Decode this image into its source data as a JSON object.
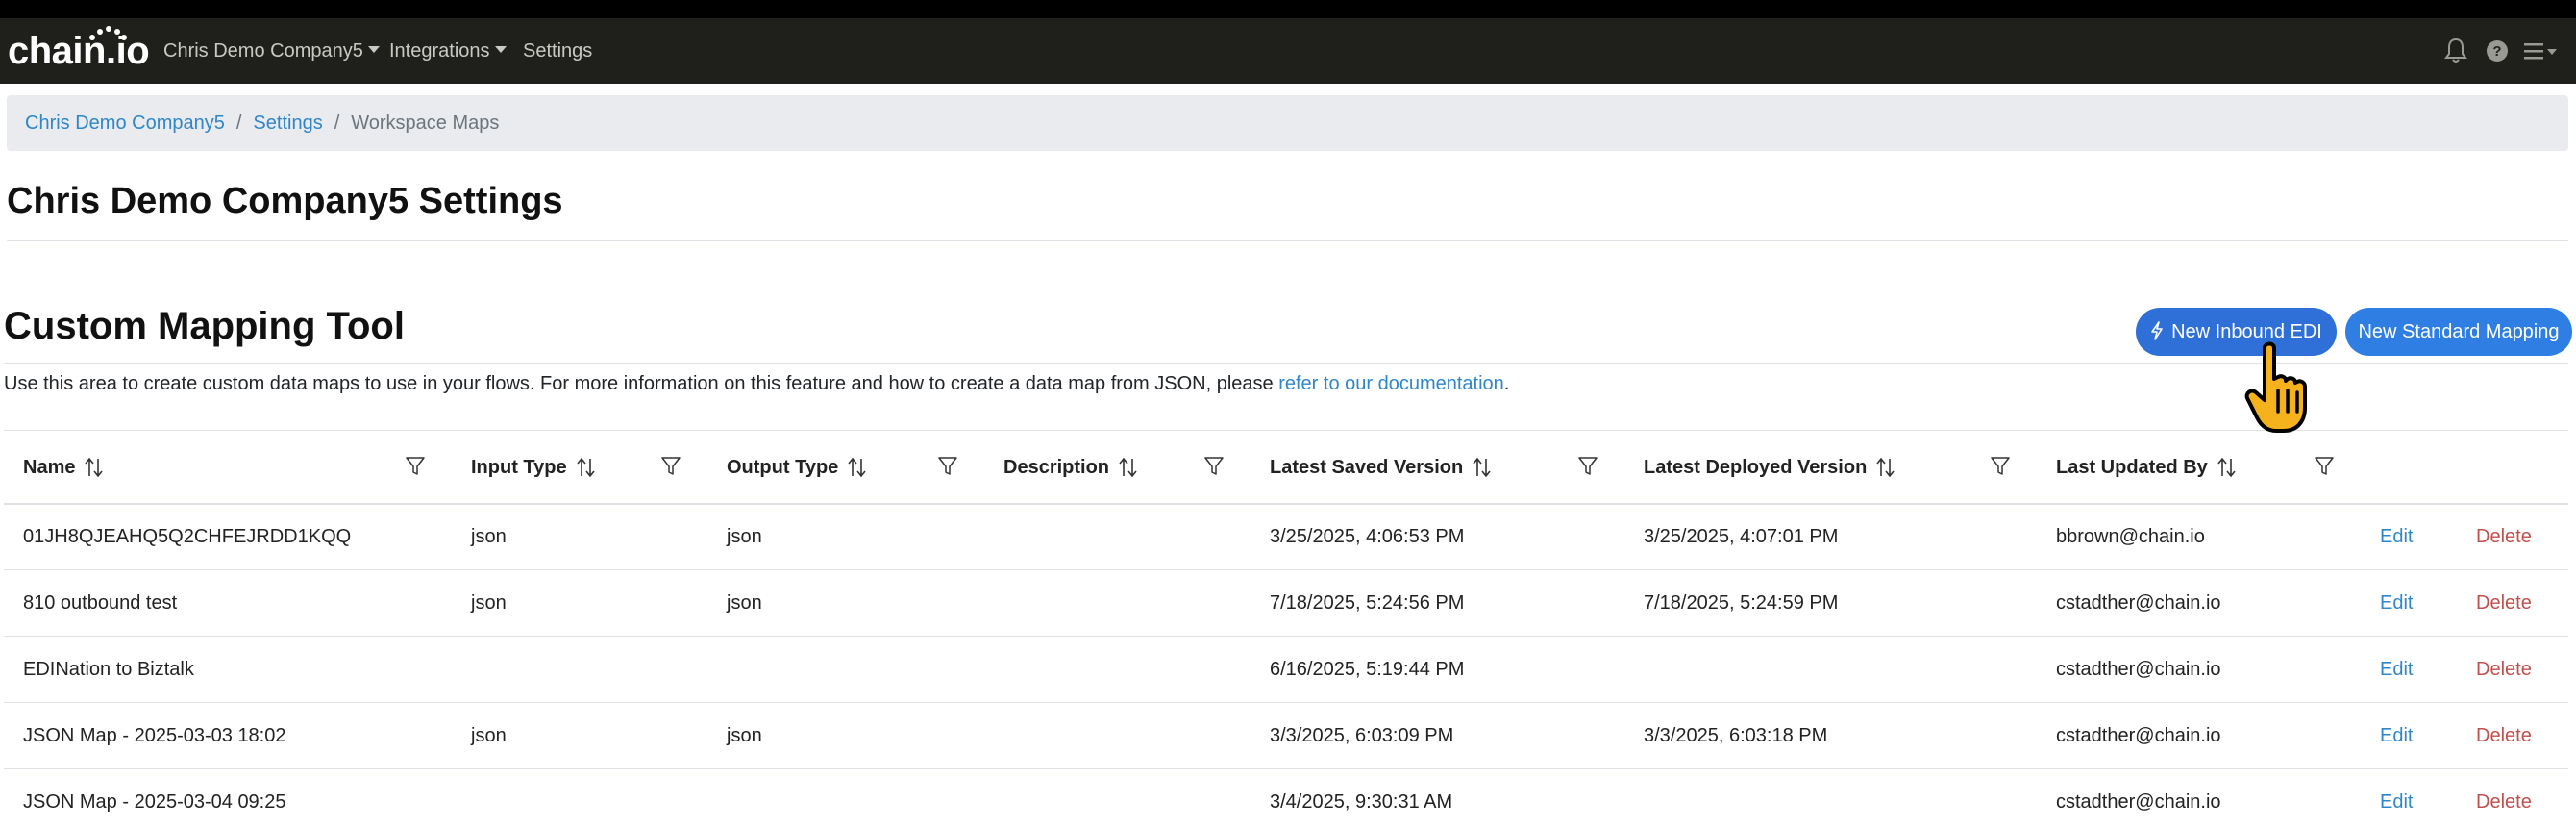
{
  "navbar": {
    "brand": "chain.io",
    "items": [
      {
        "label": "Chris Demo Company5",
        "dropdown": true
      },
      {
        "label": "Integrations",
        "dropdown": true
      },
      {
        "label": "Settings",
        "dropdown": false
      }
    ],
    "icons": [
      "bell-icon",
      "help-icon",
      "hamburger-menu-icon"
    ]
  },
  "breadcrumb": {
    "items": [
      "Chris Demo Company5",
      "Settings"
    ],
    "active": "Workspace Maps",
    "separator": "/"
  },
  "page": {
    "title": "Chris Demo Company5 Settings"
  },
  "section": {
    "title": "Custom Mapping Tool",
    "description_prefix": "Use this area to create custom data maps to use in your flows. For more information on this feature and how to create a data map from JSON, please ",
    "description_link": "refer to our documentation",
    "description_suffix": "."
  },
  "buttons": {
    "new_inbound_edi": "New Inbound EDI",
    "new_standard_mapping": "New Standard Mapping"
  },
  "table": {
    "headers": [
      "Name",
      "Input Type",
      "Output Type",
      "Description",
      "Latest Saved Version",
      "Latest Deployed Version",
      "Last Updated By"
    ],
    "rows": [
      {
        "name": "01JH8QJEAHQ5Q2CHFEJRDD1KQQ",
        "input": "json",
        "output": "json",
        "description": "",
        "saved": "3/25/2025, 4:06:53 PM",
        "deployed": "3/25/2025, 4:07:01 PM",
        "updated_by": "bbrown@chain.io",
        "edit": "Edit",
        "delete": "Delete"
      },
      {
        "name": "810 outbound test",
        "input": "json",
        "output": "json",
        "description": "",
        "saved": "7/18/2025, 5:24:56 PM",
        "deployed": "7/18/2025, 5:24:59 PM",
        "updated_by": "cstadther@chain.io",
        "edit": "Edit",
        "delete": "Delete"
      },
      {
        "name": "EDINation to Biztalk",
        "input": "",
        "output": "",
        "description": "",
        "saved": "6/16/2025, 5:19:44 PM",
        "deployed": "",
        "updated_by": "cstadther@chain.io",
        "edit": "Edit",
        "delete": "Delete"
      },
      {
        "name": "JSON Map - 2025-03-03 18:02",
        "input": "json",
        "output": "json",
        "description": "",
        "saved": "3/3/2025, 6:03:09 PM",
        "deployed": "3/3/2025, 6:03:18 PM",
        "updated_by": "cstadther@chain.io",
        "edit": "Edit",
        "delete": "Delete"
      },
      {
        "name": "JSON Map - 2025-03-04 09:25",
        "input": "",
        "output": "",
        "description": "",
        "saved": "3/4/2025, 9:30:31 AM",
        "deployed": "",
        "updated_by": "cstadther@chain.io",
        "edit": "Edit",
        "delete": "Delete"
      }
    ]
  },
  "colors": {
    "navbar_bg": "#1f1f1b",
    "link": "#2f86c9",
    "primary_button": "#2e6fd8",
    "delete": "#c0504d"
  }
}
